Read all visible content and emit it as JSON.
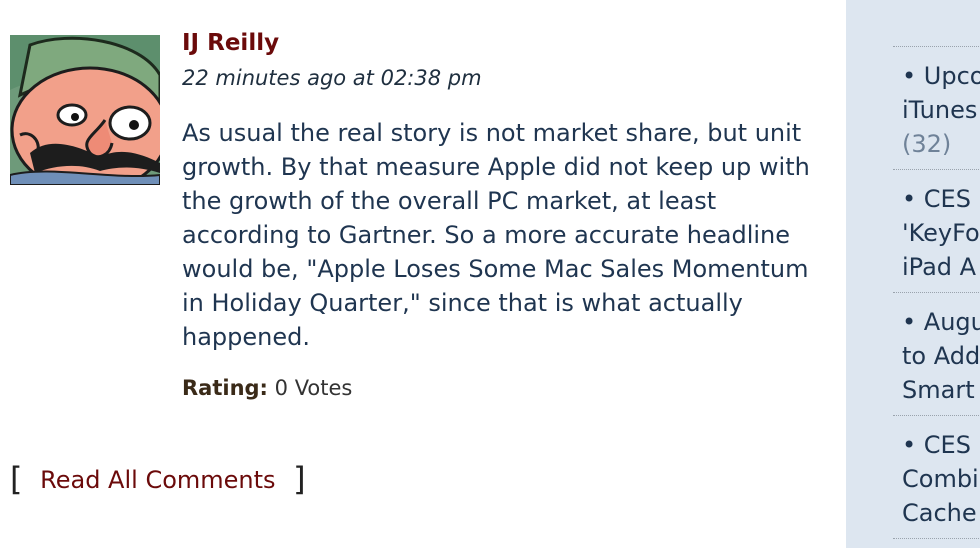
{
  "comment": {
    "author": "IJ Reilly",
    "timestamp": "22 minutes ago at 02:38 pm",
    "text": "As usual the real story is not market share, but unit growth. By that measure Apple did not keep up with the growth of the overall PC market, at least according to Gartner. So a more accurate headline would be, \"Apple Loses Some Mac Sales Momentum in Holiday Quarter,\" since that is what actually happened.",
    "rating_label": "Rating:",
    "rating_value": "0 Votes"
  },
  "read_all": {
    "open": "[",
    "label": "Read All Comments",
    "close": "]"
  },
  "sidebar": {
    "items": [
      {
        "line1": "• Upco",
        "line2": "iTunes",
        "count": "(32)"
      },
      {
        "line1": "• CES",
        "line2": "'KeyFo",
        "line3": "iPad A"
      },
      {
        "line1": "• Augu",
        "line2": "to Add",
        "line3": "Smart"
      },
      {
        "line1": "• CES",
        "line2": "Combi",
        "line3": "Cache"
      }
    ]
  }
}
